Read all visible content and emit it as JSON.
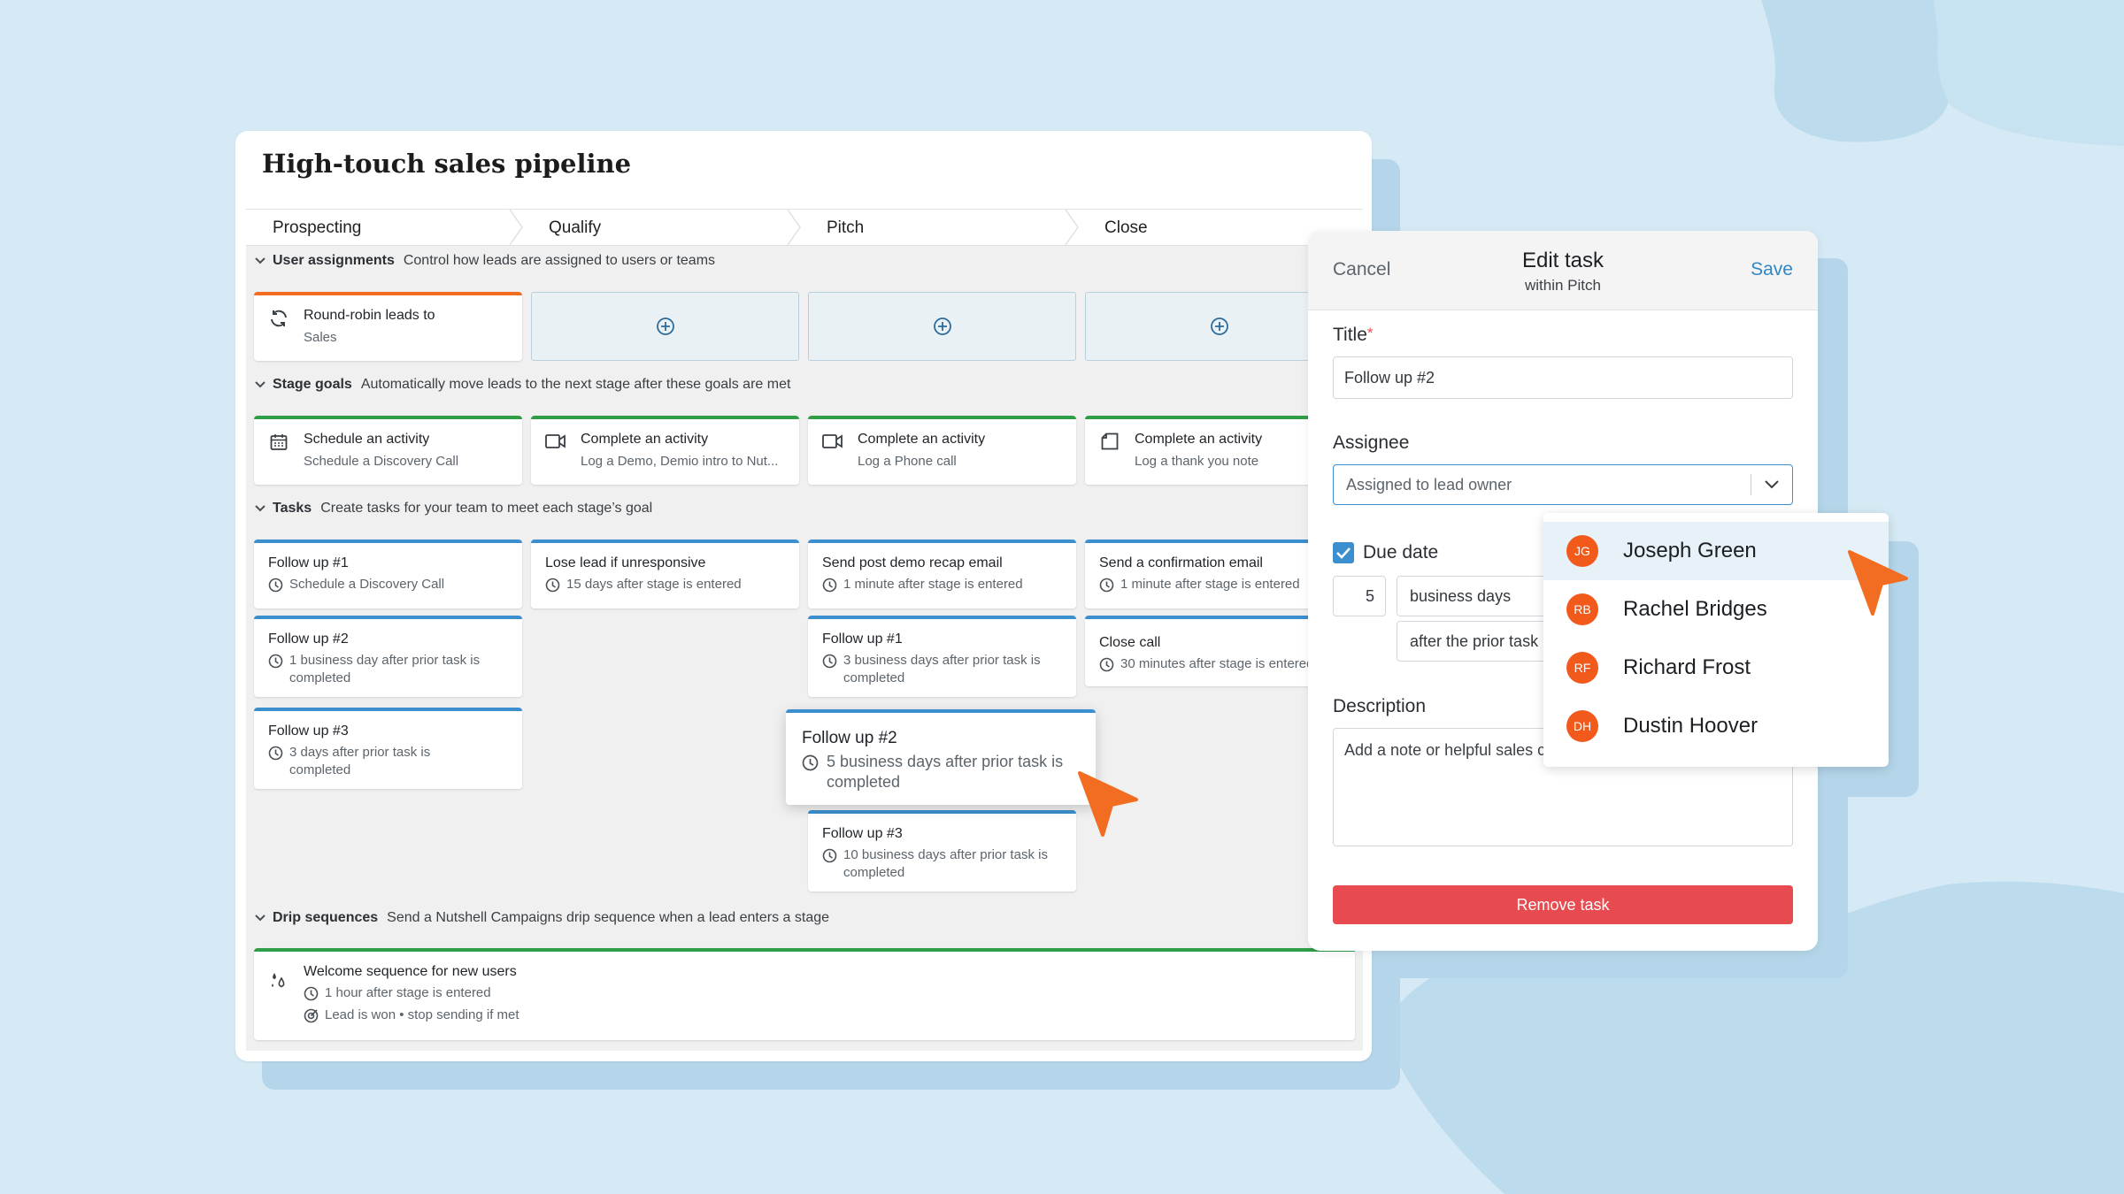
{
  "pipeline": {
    "title": "High-touch sales pipeline",
    "stages": [
      "Prospecting",
      "Qualify",
      "Pitch",
      "Close"
    ]
  },
  "sections": {
    "user_assignments": {
      "title": "User assignments",
      "desc": "Control how leads are assigned to users or teams"
    },
    "stage_goals": {
      "title": "Stage goals",
      "desc": "Automatically move leads to the next stage after these goals are met"
    },
    "tasks": {
      "title": "Tasks",
      "desc": "Create tasks for your team to meet each stage’s goal"
    },
    "drip": {
      "title": "Drip sequences",
      "desc": "Send a Nutshell Campaigns drip sequence when a lead enters a stage"
    }
  },
  "assignment": {
    "title": "Round-robin leads to",
    "sub": "Sales"
  },
  "goals": [
    {
      "title": "Schedule an activity",
      "sub": "Schedule a Discovery Call",
      "icon": "calendar-icon"
    },
    {
      "title": "Complete an activity",
      "sub": "Log a Demo, Demio intro to Nut...",
      "icon": "video-icon"
    },
    {
      "title": "Complete an activity",
      "sub": "Log a Phone call",
      "icon": "video-icon"
    },
    {
      "title": "Complete an activity",
      "sub": "Log a thank you note",
      "icon": "note-icon"
    }
  ],
  "tasks": {
    "prospecting": [
      {
        "title": "Follow up #1",
        "sub": "Schedule a Discovery Call"
      },
      {
        "title": "Follow up #2",
        "sub": "1 business day after prior task is completed"
      },
      {
        "title": "Follow up #3",
        "sub": "3 days after prior task is completed"
      }
    ],
    "qualify": [
      {
        "title": "Lose lead if unresponsive",
        "sub": "15 days after stage is entered"
      }
    ],
    "pitch": [
      {
        "title": "Send post demo recap email",
        "sub": "1 minute after stage is entered"
      },
      {
        "title": "Follow up #1",
        "sub": "3 business days after prior task is completed"
      },
      {
        "title": "Follow up #2",
        "sub": "5 business days after prior task is completed"
      },
      {
        "title": "Follow up #3",
        "sub": "10 business days after prior task is completed"
      }
    ],
    "close": [
      {
        "title": "Send a confirmation email",
        "sub": "1 minute after stage is entered"
      },
      {
        "title": "Close call",
        "sub": "30 minutes after stage is entered"
      }
    ]
  },
  "drip": {
    "title": "Welcome sequence for new users",
    "timing": "1 hour after stage is entered",
    "stop": "Lead is won • stop sending if met"
  },
  "edit": {
    "cancel": "Cancel",
    "title": "Edit task",
    "subtitle": "within Pitch",
    "save": "Save",
    "title_label": "Title",
    "required": "*",
    "title_value": "Follow up #2",
    "assignee_label": "Assignee",
    "assignee_value": "Assigned to lead owner",
    "due_label": "Due date",
    "due_checked": true,
    "due_number": "5",
    "due_unit": "business days",
    "due_relative": "after the prior task",
    "description_label": "Description",
    "description_placeholder": "Add a note or helpful sales c",
    "remove": "Remove task"
  },
  "assignee_options": [
    {
      "initials": "JG",
      "name": "Joseph Green",
      "highlighted": true
    },
    {
      "initials": "RB",
      "name": "Rachel Bridges"
    },
    {
      "initials": "RF",
      "name": "Richard Frost"
    },
    {
      "initials": "DH",
      "name": "Dustin Hoover"
    }
  ],
  "colors": {
    "background": "#d6eaf5",
    "accent_orange": "#f26d21",
    "assignment_line": "#f26d21",
    "goal_line": "#2e9e49",
    "task_line": "#3b8fcf",
    "remove_button": "#e84b4f",
    "link_blue": "#2f87c6",
    "avatar": "#f25a1c"
  }
}
